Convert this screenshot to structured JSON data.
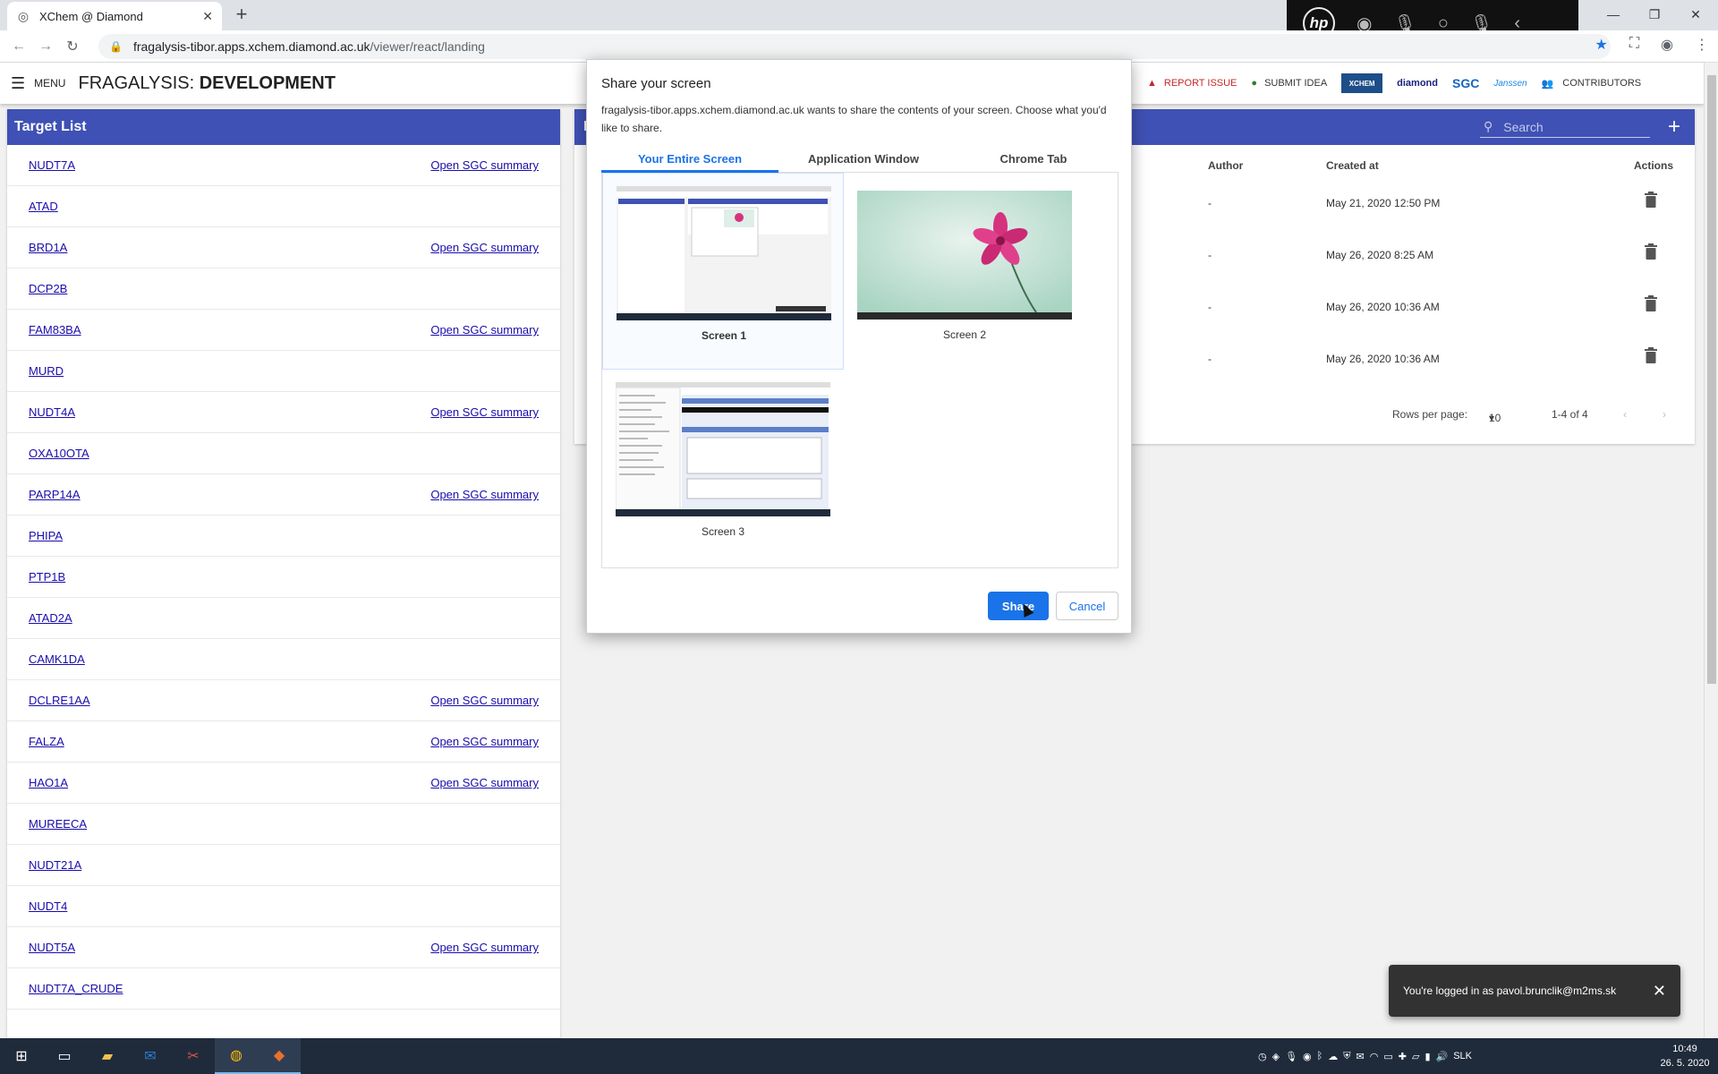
{
  "browser": {
    "tab_title": "XChem @ Diamond",
    "url_host": "fragalysis-tibor.apps.xchem.diamond.ac.uk",
    "url_path": "/viewer/react/landing"
  },
  "appbar": {
    "menu_label": "MENU",
    "title_prefix": "FRAGALYSIS: ",
    "title_bold": "DEVELOPMENT",
    "report_issue": "REPORT ISSUE",
    "submit_idea": "SUBMIT IDEA",
    "logos": [
      "XCHEM",
      "diamond",
      "SGC",
      "Janssen"
    ],
    "contributors": "CONTRIBUTORS"
  },
  "target_list": {
    "title": "Target List",
    "sgc_link_label": "Open SGC summary",
    "targets": [
      {
        "name": "NUDT7A",
        "sgc": "Open SGC summary"
      },
      {
        "name": "ATAD",
        "sgc": ""
      },
      {
        "name": "BRD1A",
        "sgc": "Open SGC summary"
      },
      {
        "name": "DCP2B",
        "sgc": ""
      },
      {
        "name": "FAM83BA",
        "sgc": "Open SGC summary"
      },
      {
        "name": "MURD",
        "sgc": ""
      },
      {
        "name": "NUDT4A",
        "sgc": "Open SGC summary"
      },
      {
        "name": "OXA10OTA",
        "sgc": ""
      },
      {
        "name": "PARP14A",
        "sgc": "Open SGC summary"
      },
      {
        "name": "PHIPA",
        "sgc": ""
      },
      {
        "name": "PTP1B",
        "sgc": ""
      },
      {
        "name": "ATAD2A",
        "sgc": ""
      },
      {
        "name": "CAMK1DA",
        "sgc": ""
      },
      {
        "name": "DCLRE1AA",
        "sgc": "Open SGC summary"
      },
      {
        "name": "FALZA",
        "sgc": "Open SGC summary"
      },
      {
        "name": "HAO1A",
        "sgc": "Open SGC summary"
      },
      {
        "name": "MUREECA",
        "sgc": ""
      },
      {
        "name": "NUDT21A",
        "sgc": ""
      },
      {
        "name": "NUDT4",
        "sgc": ""
      },
      {
        "name": "NUDT5A",
        "sgc": "Open SGC summary"
      },
      {
        "name": "NUDT7A_CRUDE",
        "sgc": ""
      }
    ]
  },
  "projects": {
    "header_initial": "P",
    "search_placeholder": "Search",
    "columns": {
      "author": "Author",
      "created_at": "Created at",
      "actions": "Actions"
    },
    "rows": [
      {
        "author": "-",
        "created_at": "May 21, 2020 12:50 PM"
      },
      {
        "author": "-",
        "created_at": "May 26, 2020 8:25 AM"
      },
      {
        "author": "-",
        "created_at": "May 26, 2020 10:36 AM"
      },
      {
        "author": "-",
        "created_at": "May 26, 2020 10:36 AM"
      }
    ],
    "rows_per_page_label": "Rows per page:",
    "rows_per_page_value": "10",
    "range": "1-4 of 4"
  },
  "share_dialog": {
    "title": "Share your screen",
    "message": "fragalysis-tibor.apps.xchem.diamond.ac.uk wants to share the contents of your screen. Choose what you'd like to share.",
    "tabs": [
      "Your Entire Screen",
      "Application Window",
      "Chrome Tab"
    ],
    "screens": [
      "Screen 1",
      "Screen 2",
      "Screen 3"
    ],
    "share_label": "Share",
    "cancel_label": "Cancel"
  },
  "snackbar": {
    "message": "You're logged in as pavol.brunclik@m2ms.sk"
  },
  "taskbar": {
    "language": "SLK",
    "time": "10:49",
    "date": "26. 5. 2020"
  },
  "colors": {
    "primary": "#3f51b5",
    "chrome_blue": "#1a73e8",
    "report_red": "#c62828",
    "idea_green": "#2e7d32"
  }
}
